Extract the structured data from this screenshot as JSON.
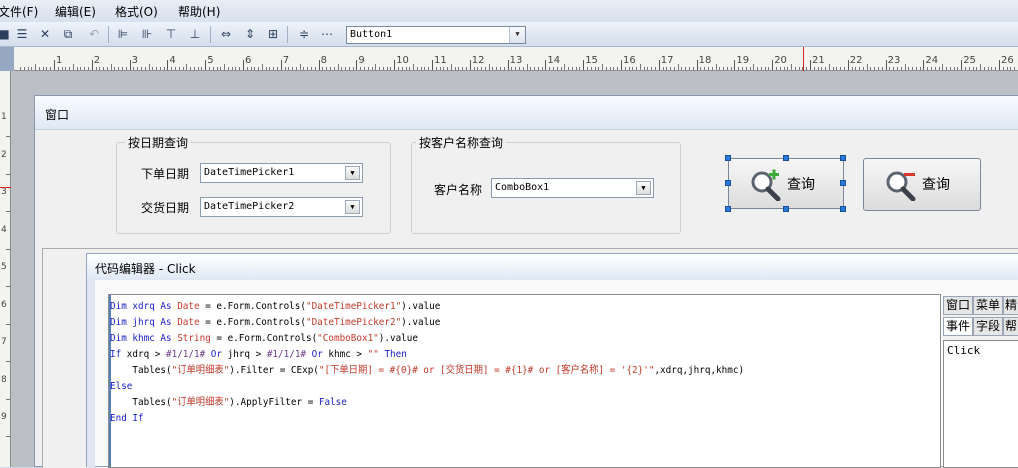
{
  "menu": {
    "file": "文件(F)",
    "edit": "编辑(E)",
    "format": "格式(O)",
    "help": "帮助(H)"
  },
  "toolbar": {
    "selected_control": "Button1",
    "icons": [
      "save-icon",
      "cut-icon",
      "delete-icon",
      "copy-icon",
      "undo-icon",
      "align-left-icon",
      "align-right-icon",
      "align-top-icon",
      "align-bottom-icon",
      "same-width-icon",
      "same-height-icon",
      "same-size-icon",
      "space-vertical-icon",
      "space-horizontal-icon"
    ]
  },
  "ruler": {
    "h_ticks": [
      "1",
      "2",
      "3",
      "4",
      "5",
      "6",
      "7",
      "8",
      "9",
      "10",
      "11",
      "12",
      "13",
      "14",
      "15",
      "16",
      "17",
      "18",
      "19",
      "20",
      "21",
      "22",
      "23",
      "24",
      "25",
      "26"
    ],
    "v_ticks": [
      "1",
      "2",
      "3",
      "4",
      "5",
      "6",
      "7",
      "8",
      "9"
    ]
  },
  "form": {
    "title": "窗口",
    "date_group": {
      "title": "按日期查询",
      "order_date_label": "下单日期",
      "order_date_value": "DateTimePicker1",
      "delivery_date_label": "交货日期",
      "delivery_date_value": "DateTimePicker2"
    },
    "customer_group": {
      "title": "按客户名称查询",
      "customer_label": "客户名称",
      "customer_value": "ComboBox1"
    },
    "query_button_label": "查询",
    "query_button2_label": "查询"
  },
  "code_editor": {
    "title": "代码编辑器 - Click",
    "lines": [
      [
        {
          "t": "Dim xdrq ",
          "c": "kw"
        },
        {
          "t": "As ",
          "c": "kw"
        },
        {
          "t": "Date",
          "c": "str"
        },
        {
          "t": " = e.Form.Controls(",
          "c": ""
        },
        {
          "t": "\"DateTimePicker1\"",
          "c": "str"
        },
        {
          "t": ").value",
          "c": ""
        }
      ],
      [
        {
          "t": "Dim jhrq ",
          "c": "kw"
        },
        {
          "t": "As ",
          "c": "kw"
        },
        {
          "t": "Date",
          "c": "str"
        },
        {
          "t": " = e.Form.Controls(",
          "c": ""
        },
        {
          "t": "\"DateTimePicker2\"",
          "c": "str"
        },
        {
          "t": ").value",
          "c": ""
        }
      ],
      [
        {
          "t": "Dim khmc ",
          "c": "kw"
        },
        {
          "t": "As ",
          "c": "kw"
        },
        {
          "t": "String",
          "c": "str"
        },
        {
          "t": " = e.Form.Controls(",
          "c": ""
        },
        {
          "t": "\"ComboBox1\"",
          "c": "str"
        },
        {
          "t": ").value",
          "c": ""
        }
      ],
      [
        {
          "t": "If ",
          "c": "kw"
        },
        {
          "t": "xdrq > ",
          "c": ""
        },
        {
          "t": "#1/1/1#",
          "c": "num"
        },
        {
          "t": " Or ",
          "c": "kw"
        },
        {
          "t": "jhrq > ",
          "c": ""
        },
        {
          "t": "#1/1/1#",
          "c": "num"
        },
        {
          "t": " Or ",
          "c": "kw"
        },
        {
          "t": "khmc > ",
          "c": ""
        },
        {
          "t": "\"\"",
          "c": "str"
        },
        {
          "t": " Then",
          "c": "kw"
        }
      ],
      [
        {
          "t": "    Tables(",
          "c": ""
        },
        {
          "t": "\"订单明细表\"",
          "c": "str"
        },
        {
          "t": ").Filter = CExp(",
          "c": ""
        },
        {
          "t": "\"[下单日期] = #{0}# or [交货日期] = #{1}# or [客户名称] = '{2}'\"",
          "c": "str"
        },
        {
          "t": ",xdrq,jhrq,khmc)",
          "c": ""
        }
      ],
      [
        {
          "t": "Else",
          "c": "kw"
        }
      ],
      [
        {
          "t": "    Tables(",
          "c": ""
        },
        {
          "t": "\"订单明细表\"",
          "c": "str"
        },
        {
          "t": ").ApplyFilter = ",
          "c": ""
        },
        {
          "t": "False",
          "c": "kw"
        }
      ],
      [
        {
          "t": "End If",
          "c": "kw"
        }
      ]
    ],
    "tabs_row1": [
      "窗口",
      "菜单",
      "精"
    ],
    "tabs_row2": [
      "事件",
      "字段",
      "帮"
    ],
    "events": [
      "Click"
    ]
  },
  "colors": {
    "keyword": "#1a22c8",
    "string": "#c0392b",
    "number": "#6b3a88",
    "selection_handle": "#2a78d8"
  }
}
